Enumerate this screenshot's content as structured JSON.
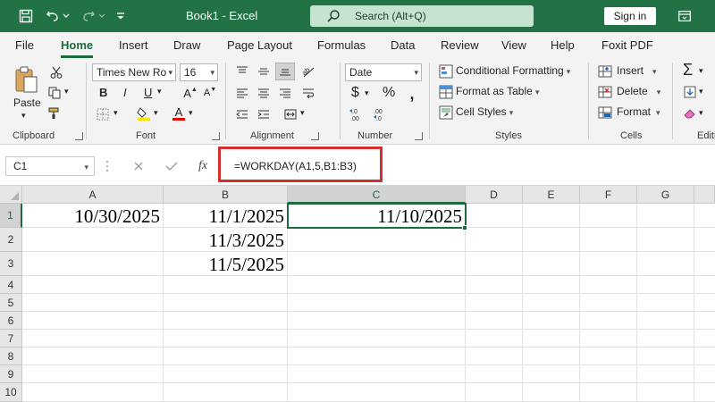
{
  "titlebar": {
    "doc_title": "Book1  -  Excel",
    "search_placeholder": "Search (Alt+Q)",
    "signin_label": "Sign in"
  },
  "tabs": [
    "File",
    "Home",
    "Insert",
    "Draw",
    "Page Layout",
    "Formulas",
    "Data",
    "Review",
    "View",
    "Help",
    "Foxit PDF"
  ],
  "active_tab": "Home",
  "ribbon": {
    "clipboard": {
      "paste_label": "Paste",
      "group_label": "Clipboard"
    },
    "font": {
      "font_name": "Times New Ro",
      "font_size": "16",
      "bold": "B",
      "italic": "I",
      "underline": "U",
      "font_color_glyph": "A",
      "group_label": "Font"
    },
    "alignment": {
      "group_label": "Alignment"
    },
    "number": {
      "format": "Date",
      "currency": "$",
      "percent": "%",
      "group_label": "Number"
    },
    "styles": {
      "conditional_formatting": "Conditional Formatting",
      "format_as_table": "Format as Table",
      "cell_styles": "Cell Styles",
      "group_label": "Styles"
    },
    "cells": {
      "insert": "Insert",
      "delete": "Delete",
      "format": "Format",
      "group_label": "Cells"
    },
    "editing": {
      "group_label": "Editi"
    }
  },
  "formula_bar": {
    "name_box": "C1",
    "fx": "fx",
    "formula": "=WORKDAY(A1,5,B1:B3)"
  },
  "grid": {
    "columns": [
      "A",
      "B",
      "C",
      "D",
      "E",
      "F",
      "G"
    ],
    "rows": [
      "1",
      "2",
      "3",
      "4",
      "5",
      "6",
      "7",
      "8",
      "9",
      "10"
    ],
    "selected_column": "C",
    "selected_row": "1",
    "cells": {
      "A1": "10/30/2025",
      "B1": "11/1/2025",
      "B2": "11/3/2025",
      "B3": "11/5/2025",
      "C1": "11/10/2025"
    }
  },
  "colors": {
    "excel_green": "#217346",
    "accent_green": "#1d6b3c",
    "highlight_red": "#d1302f"
  }
}
